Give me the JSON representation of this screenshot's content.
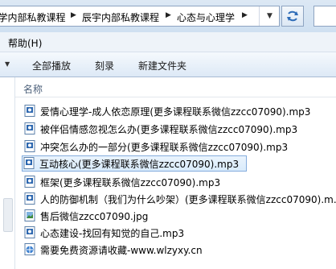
{
  "address": {
    "crumbs": [
      "...学内部私教课程",
      "辰宇内部私教课程",
      "心态与心理学"
    ],
    "refresh_icon": "refresh-icon"
  },
  "menu": {
    "help": "帮助(H)"
  },
  "toolbar": {
    "play_all": "全部播放",
    "burn": "刻录",
    "new_folder": "新建文件夹"
  },
  "columns": {
    "name": "名称"
  },
  "files": [
    {
      "name": "爱情心理学-成人依恋原理(更多课程联系微信zzcc07090).mp3",
      "icon": "mp3-file-icon"
    },
    {
      "name": "被伴侣情感忽视怎么办(更多课程联系微信zzcc07090).mp3",
      "icon": "mp3-file-icon"
    },
    {
      "name": "冲突怎么办的一部分(更多课程联系微信zzcc07090).mp3",
      "icon": "mp3-file-icon"
    },
    {
      "name": "互动核心(更多课程联系微信zzcc07090).mp3",
      "icon": "mp3-file-icon",
      "selected": true
    },
    {
      "name": "框架(更多课程联系微信zzcc07090).mp3",
      "icon": "mp3-file-icon"
    },
    {
      "name": "人的防御机制（我们为什么吵架）(更多课程联系微信zzcc07090).m...",
      "icon": "mp3-file-icon"
    },
    {
      "name": "售后微信zzcc07090.jpg",
      "icon": "jpg-file-icon"
    },
    {
      "name": "心态建设-找回有知觉的自己.mp3",
      "icon": "mp3-file-icon"
    },
    {
      "name": "需要免费资源请收藏-www.wlzyxy.cn",
      "icon": "url-file-icon"
    }
  ],
  "colors": {
    "selection_border": "#84acdd",
    "header_text": "#4c607a"
  }
}
